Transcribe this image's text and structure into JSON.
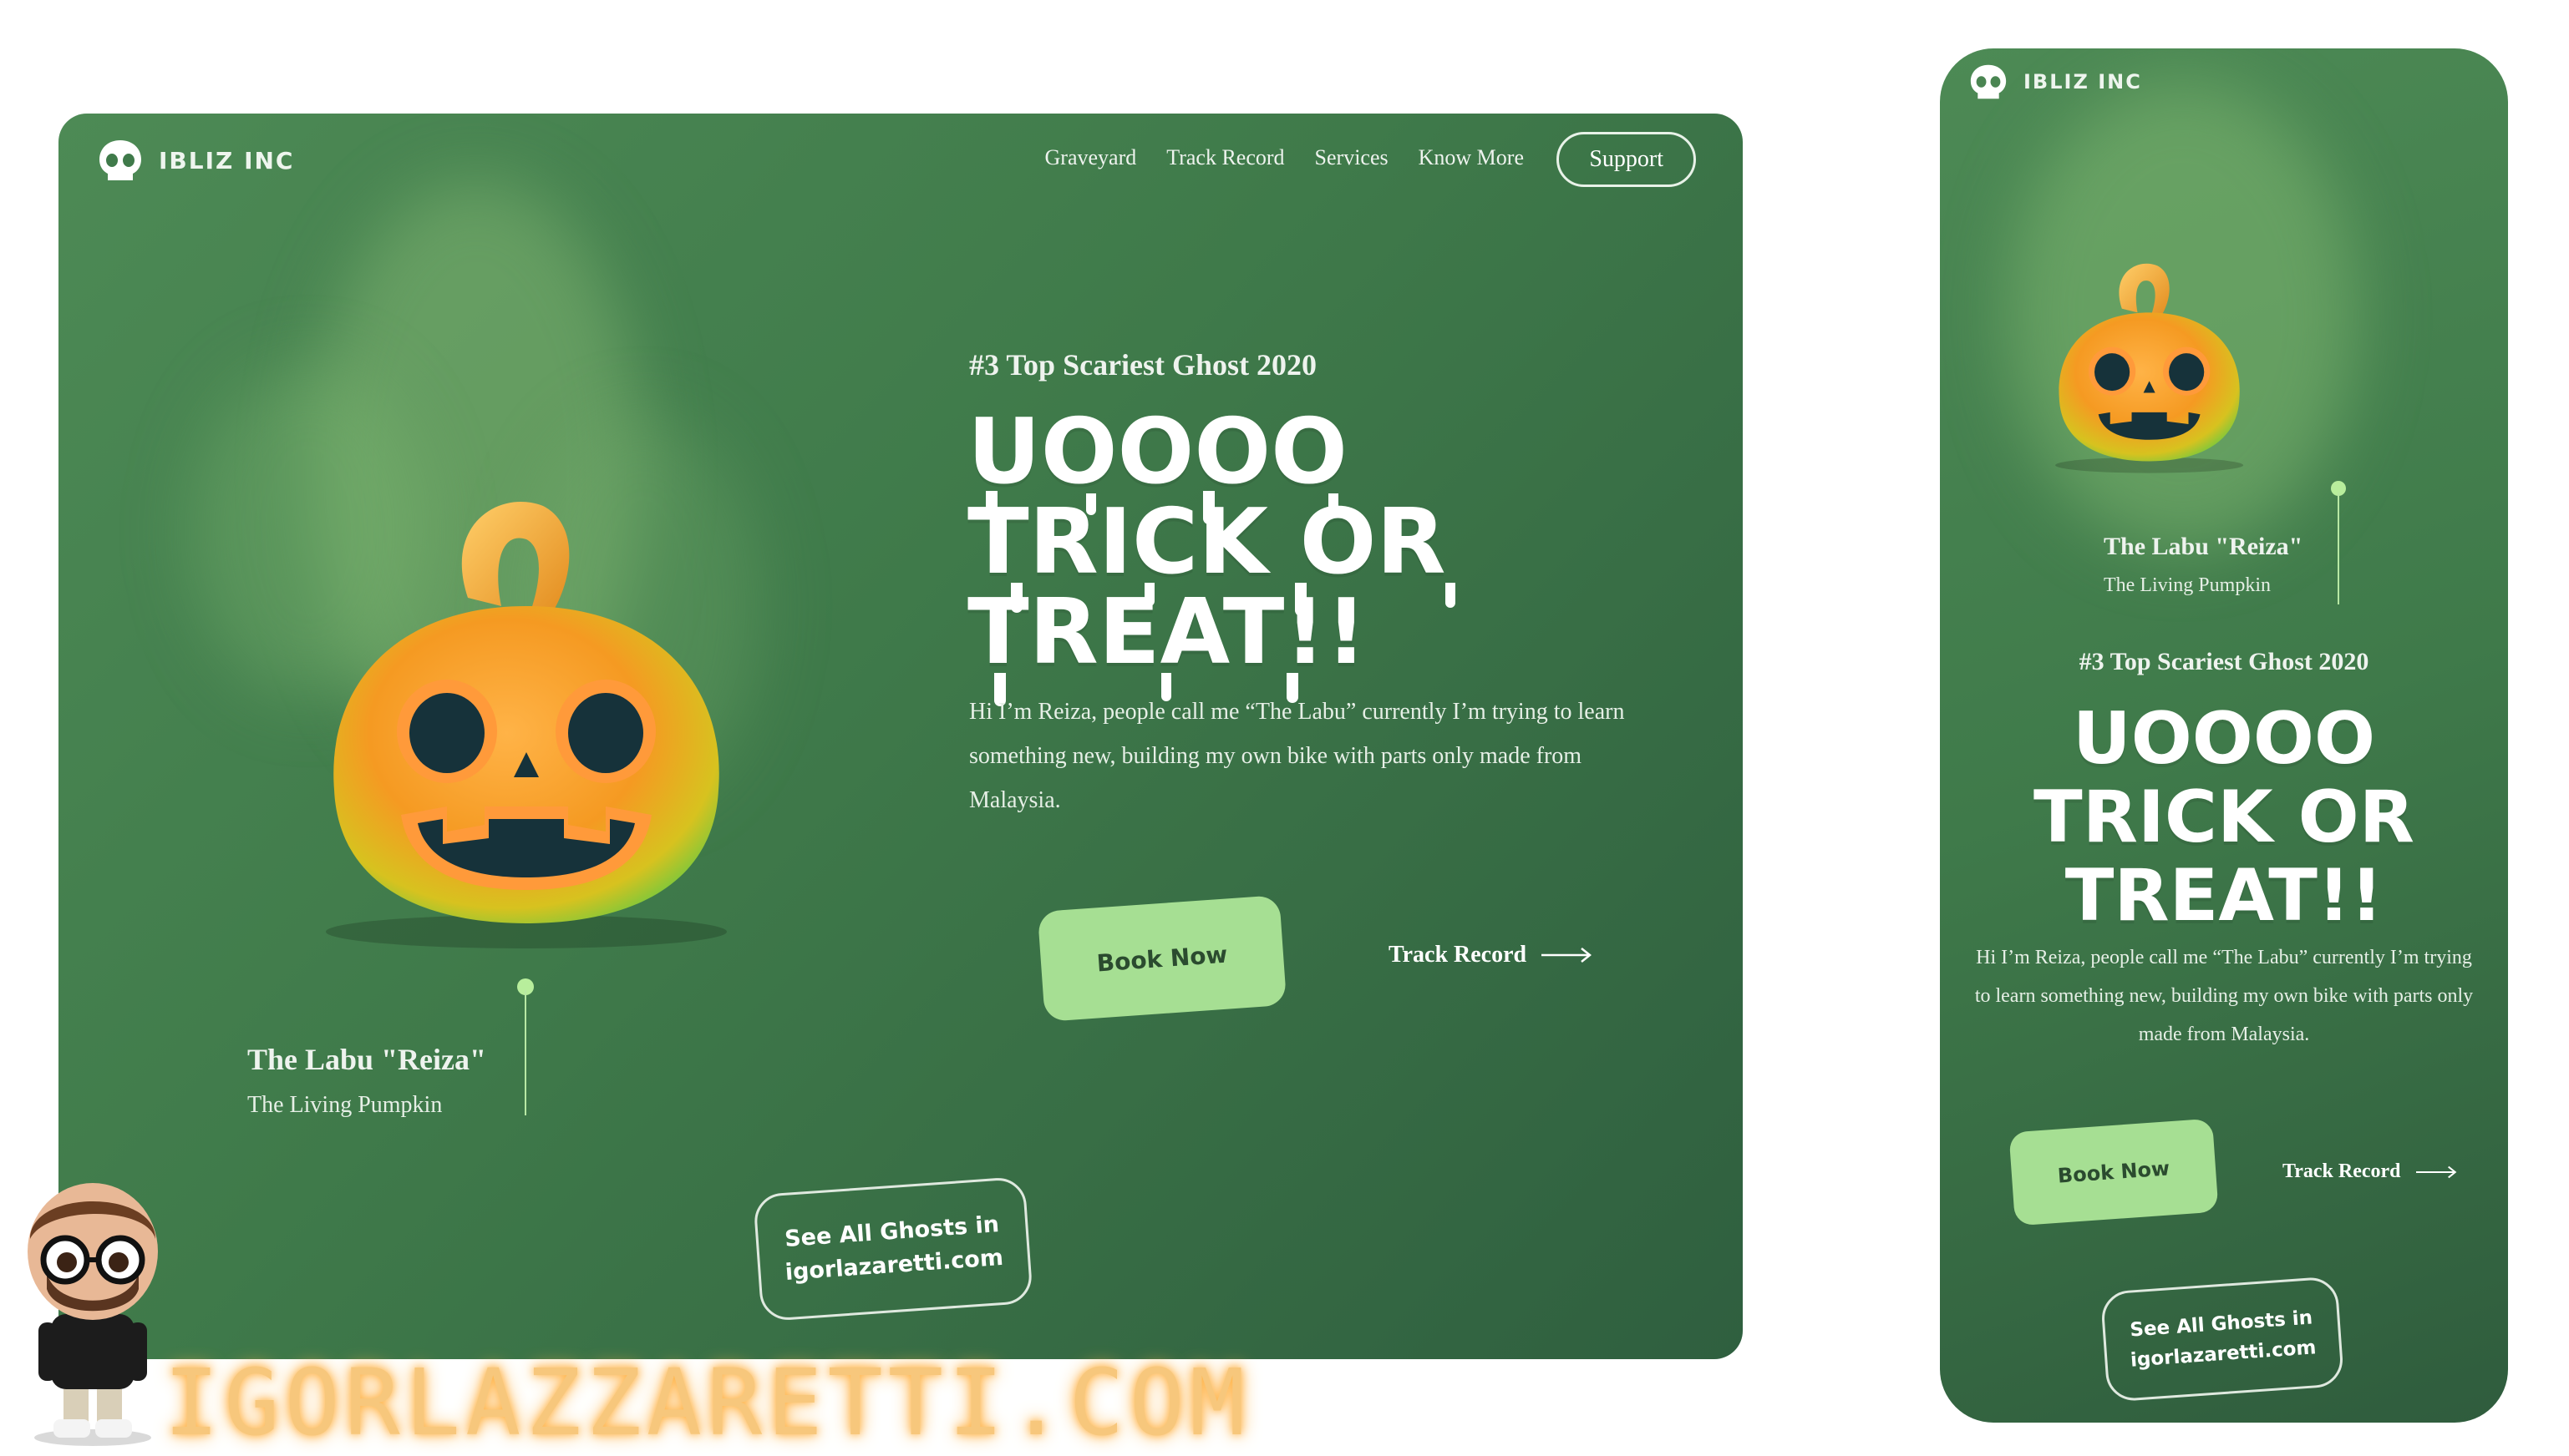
{
  "brand": {
    "name": "IBLIZ INC"
  },
  "nav": {
    "items": [
      "Graveyard",
      "Track Record",
      "Services",
      "Know More"
    ],
    "support": "Support"
  },
  "hero": {
    "tagline": "#3 Top Scariest Ghost 2020",
    "line1": "UOOOO",
    "line2": "TRICK OR",
    "line3": "TREAT!!",
    "description": "Hi I’m Reiza, people call me “The Labu” currently I’m trying to learn something new, building my own bike with parts only made from Malaysia."
  },
  "character": {
    "name": "The Labu \"Reiza\"",
    "subtitle": "The Living Pumpkin"
  },
  "cta": {
    "book": "Book Now",
    "track": "Track Record"
  },
  "see_all": {
    "line1": "See All Ghosts in",
    "line2": "igorlazaretti.com"
  },
  "watermark": "IGORLAZZARETTI.COM",
  "colors": {
    "card_green": "#4d8a55",
    "accent_green": "#a6df93",
    "watermark": "#f7c77c"
  },
  "icons": [
    "skull-icon",
    "arrow-right-icon",
    "pumpkin-illustration",
    "avatar-figure"
  ]
}
